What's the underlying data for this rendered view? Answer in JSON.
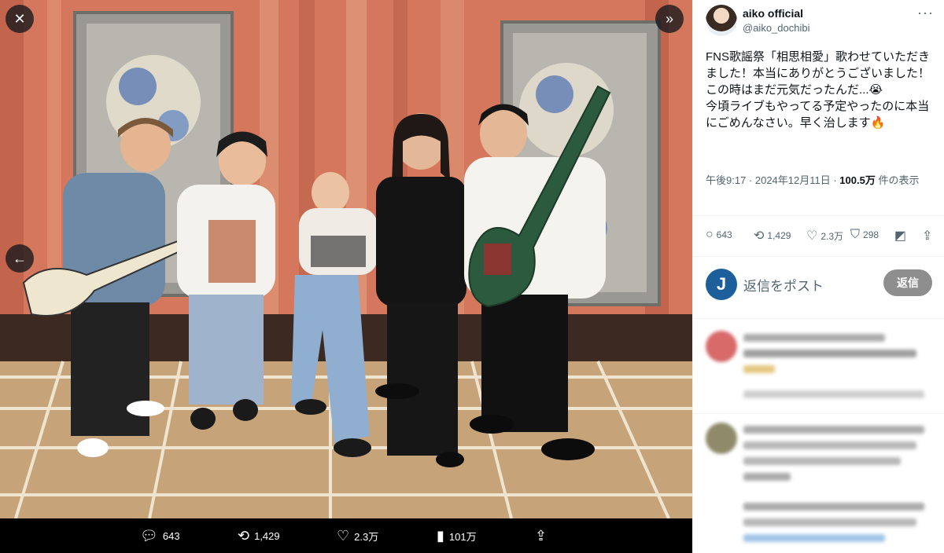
{
  "viewer": {
    "close_icon": "close-icon",
    "expand_icon": "expand-icon",
    "prev_icon": "arrow-left-icon",
    "actions": {
      "replies": "643",
      "reposts": "1,429",
      "likes": "2.3万",
      "views": "101万"
    }
  },
  "tweet": {
    "display_name": "aiko official",
    "handle": "@aiko_dochibi",
    "text": "FNS歌謡祭「相思相愛」歌わせていただきました！本当にありがとうございました！この時はまだ元気だったんだ...😭\n今頃ライブもやってる予定やったのに本当にごめんなさい。早く治します🔥",
    "time": "午後9:17 · 2024年12月11日 · ",
    "views_count": "100.5万",
    "views_label": " 件の表示",
    "stats": {
      "replies": "643",
      "reposts": "1,429",
      "likes": "2.3万",
      "bookmarks": "298"
    }
  },
  "reply_box": {
    "avatar_letter": "J",
    "placeholder": "返信をポスト",
    "button": "返信"
  },
  "colors": {
    "accent": "#1d9bf0",
    "text": "#0f1419",
    "muted": "#536471"
  }
}
